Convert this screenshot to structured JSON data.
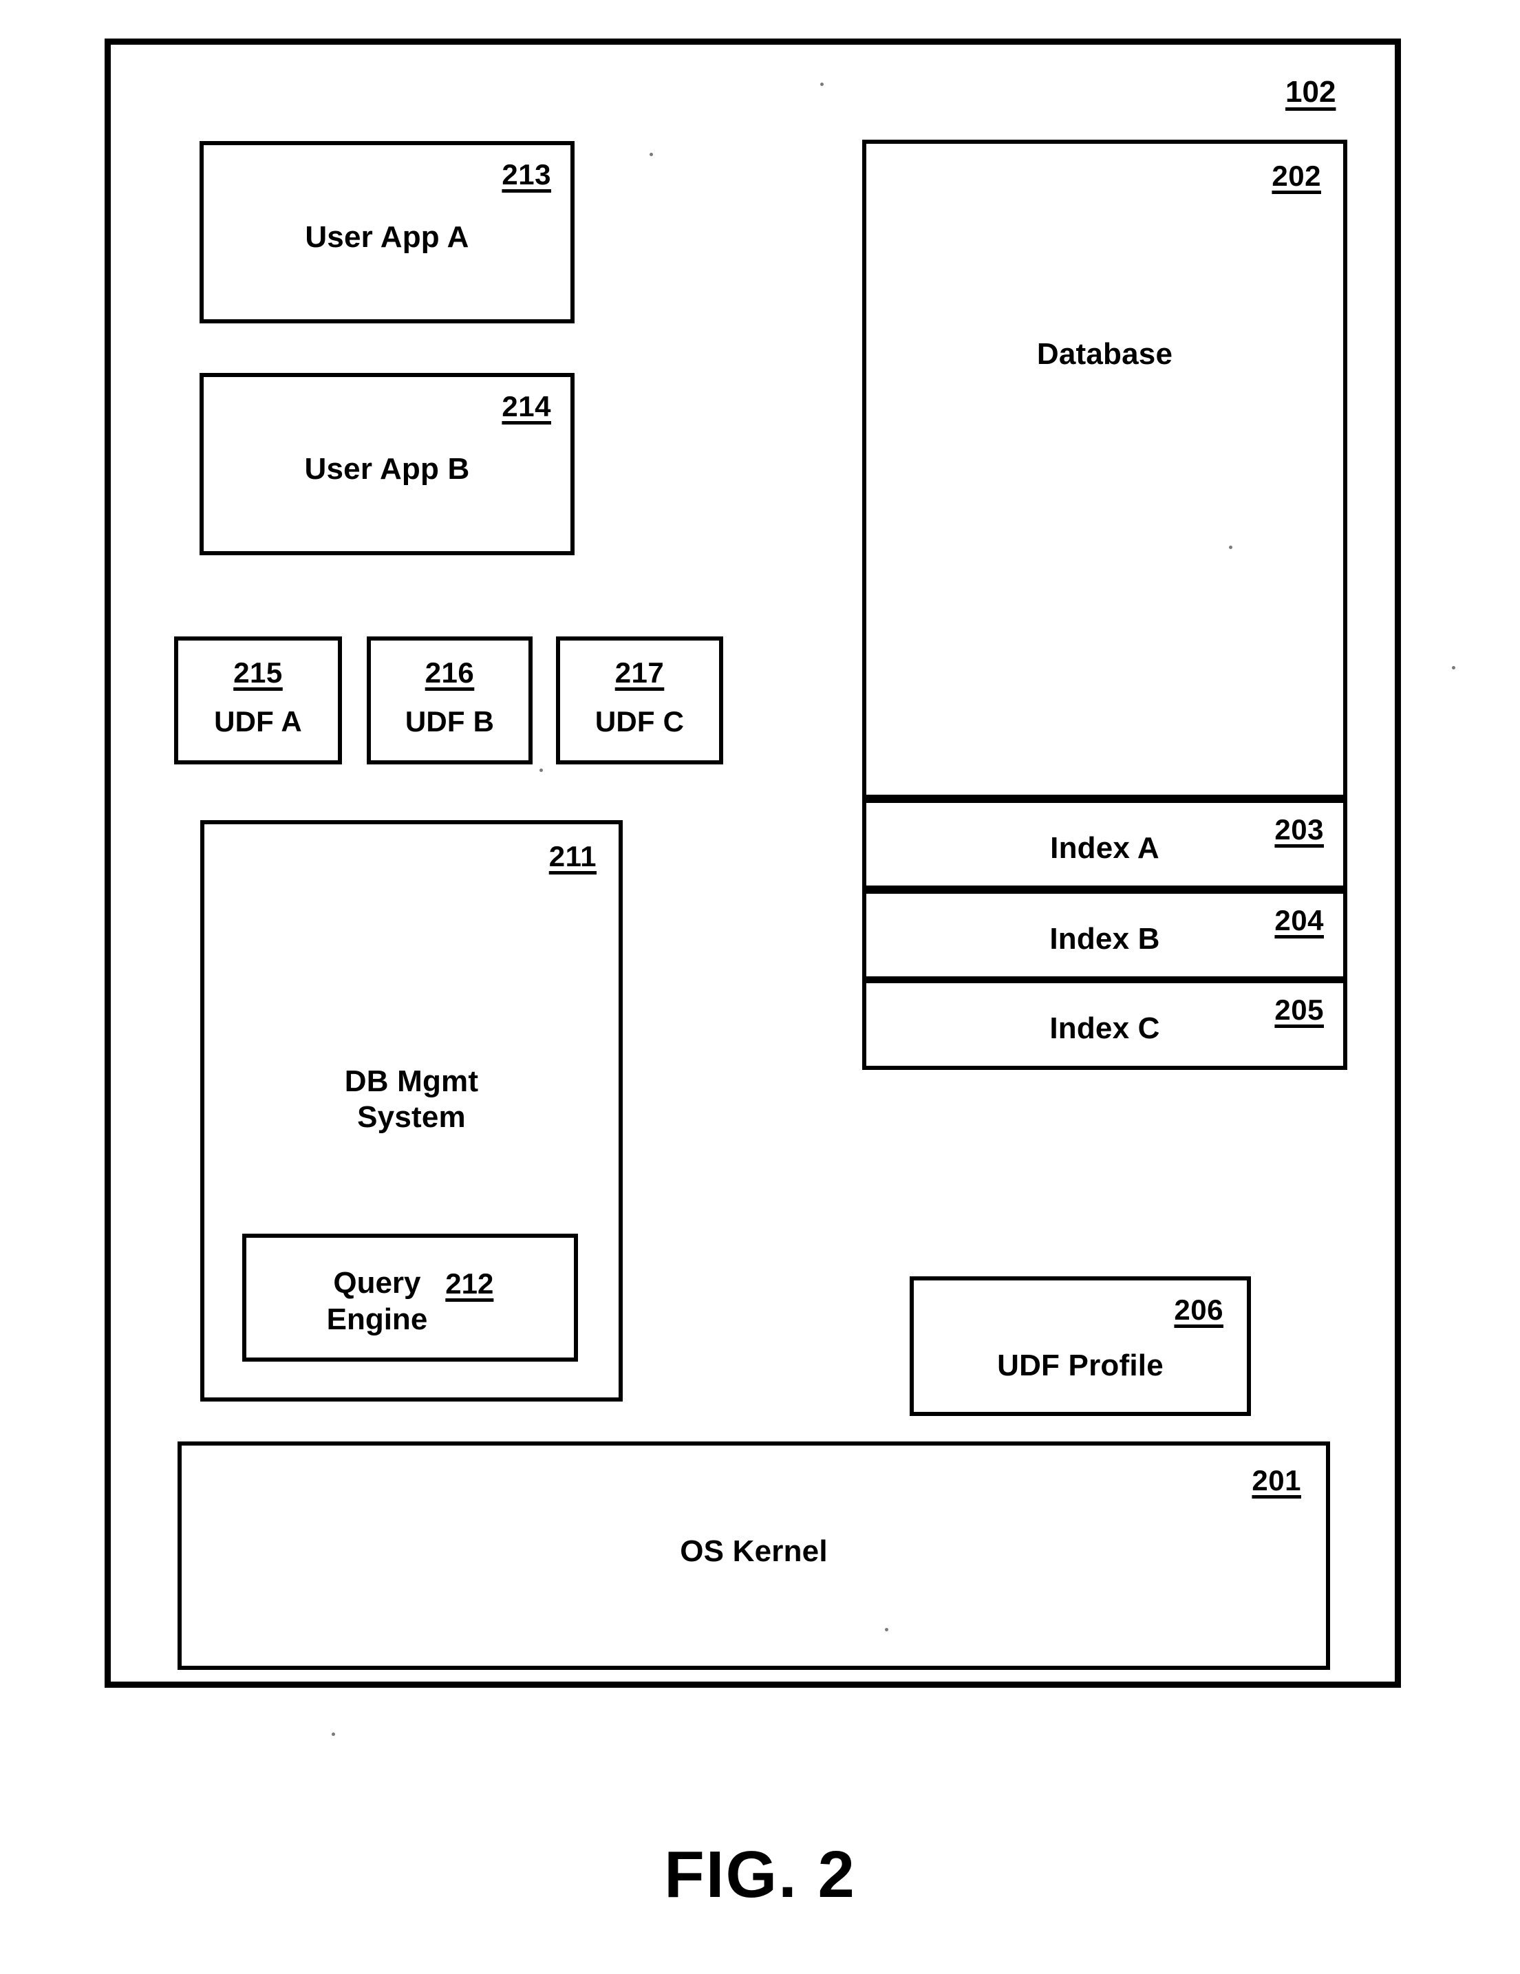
{
  "figure": {
    "caption": "FIG. 2",
    "system_ref": "102"
  },
  "blocks": {
    "user_app_a": {
      "label": "User App A",
      "ref": "213"
    },
    "user_app_b": {
      "label": "User App B",
      "ref": "214"
    },
    "udf_a": {
      "label": "UDF A",
      "ref": "215"
    },
    "udf_b": {
      "label": "UDF B",
      "ref": "216"
    },
    "udf_c": {
      "label": "UDF C",
      "ref": "217"
    },
    "dbms": {
      "label": "DB Mgmt\nSystem",
      "ref": "211"
    },
    "query_engine": {
      "label": "Query\nEngine",
      "ref": "212"
    },
    "database": {
      "label": "Database",
      "ref": "202"
    },
    "index_a": {
      "label": "Index A",
      "ref": "203"
    },
    "index_b": {
      "label": "Index B",
      "ref": "204"
    },
    "index_c": {
      "label": "Index C",
      "ref": "205"
    },
    "udf_profile": {
      "label": "UDF Profile",
      "ref": "206"
    },
    "os_kernel": {
      "label": "OS Kernel",
      "ref": "201"
    }
  },
  "colors": {
    "ink": "#000000",
    "paper": "#ffffff"
  }
}
